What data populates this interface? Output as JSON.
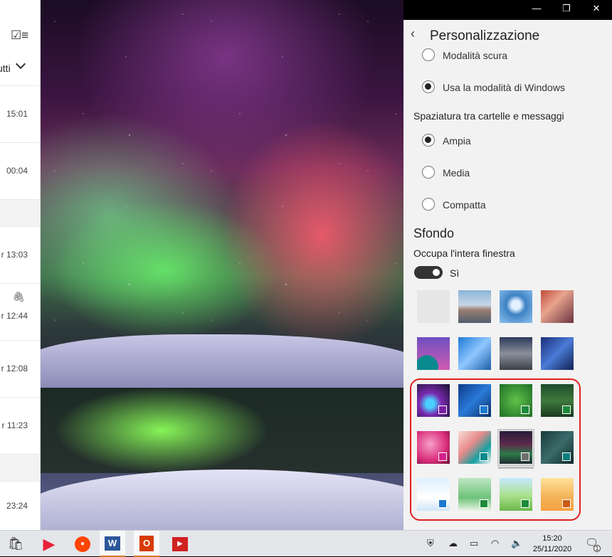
{
  "window_controls": {
    "minimize": "—",
    "restore": "❐",
    "close": "✕"
  },
  "mail_list": {
    "filter_icon": "☑≡",
    "filter_label": "utti",
    "rows": [
      {
        "time": "15:01",
        "group": false
      },
      {
        "time": "00:04",
        "group": false
      },
      {
        "time": "",
        "group": true
      },
      {
        "time": "r 13:03",
        "group": false
      },
      {
        "time": "r 12:44",
        "group": false,
        "attachment": true
      },
      {
        "time": "r 12:08",
        "group": false
      },
      {
        "time": "r 11:23",
        "group": false
      },
      {
        "time": "",
        "group": true
      },
      {
        "time": "23:24",
        "group": false
      }
    ]
  },
  "panel": {
    "back_icon": "‹",
    "title": "Personalizzazione",
    "mode_options": [
      {
        "label": "Modalità scura",
        "selected": false
      },
      {
        "label": "Usa la modalità di Windows",
        "selected": true
      }
    ],
    "spacing_heading": "Spaziatura tra cartelle e messaggi",
    "spacing_options": [
      {
        "label": "Ampia",
        "selected": true
      },
      {
        "label": "Media",
        "selected": false
      },
      {
        "label": "Compatta",
        "selected": false
      }
    ],
    "background_heading": "Sfondo",
    "fill_window_label": "Occupa l'intera finestra",
    "fill_window_toggle": "Sì",
    "backgrounds": [
      {
        "name": "blank",
        "swatch": ""
      },
      {
        "name": "mountain",
        "swatch": ""
      },
      {
        "name": "tree",
        "swatch": ""
      },
      {
        "name": "canyon",
        "swatch": ""
      },
      {
        "name": "waves",
        "swatch": ""
      },
      {
        "name": "blue-geometric",
        "swatch": ""
      },
      {
        "name": "lake-sunset",
        "swatch": ""
      },
      {
        "name": "blue-streaks",
        "swatch": ""
      },
      {
        "name": "galaxy",
        "swatch": "#7a1fa0"
      },
      {
        "name": "blue-abstract",
        "swatch": "#1a79d0"
      },
      {
        "name": "clover",
        "swatch": "#1d8a3a"
      },
      {
        "name": "forest",
        "swatch": "#1d8a3a"
      },
      {
        "name": "pink-flower",
        "swatch": "#d31f8c"
      },
      {
        "name": "pink-waves",
        "swatch": "#0d8a8a"
      },
      {
        "name": "aurora",
        "swatch": "#6f6f6f",
        "selected": true
      },
      {
        "name": "teal-leaves",
        "swatch": "#0d7d7d"
      },
      {
        "name": "snowman",
        "swatch": "#1a79d0"
      },
      {
        "name": "green-hills",
        "swatch": "#1d8a3a"
      },
      {
        "name": "spring-field",
        "swatch": "#1d8a3a"
      },
      {
        "name": "scarecrow",
        "swatch": "#c85b16"
      }
    ]
  },
  "taskbar": {
    "apps": [
      {
        "name": "store",
        "glyph": "🛍"
      },
      {
        "name": "media-player",
        "glyph": "▶"
      },
      {
        "name": "reddit",
        "glyph": "●"
      },
      {
        "name": "word",
        "glyph": "W"
      },
      {
        "name": "office",
        "glyph": "O"
      },
      {
        "name": "presentation",
        "glyph": "▶"
      }
    ],
    "time": "15:20",
    "date": "25/11/2020",
    "notification_count": "1"
  },
  "colors": {
    "highlight": "#e0201f",
    "panel_bg": "#f2f2f2",
    "taskbar_bg": "#e4e6ea"
  }
}
